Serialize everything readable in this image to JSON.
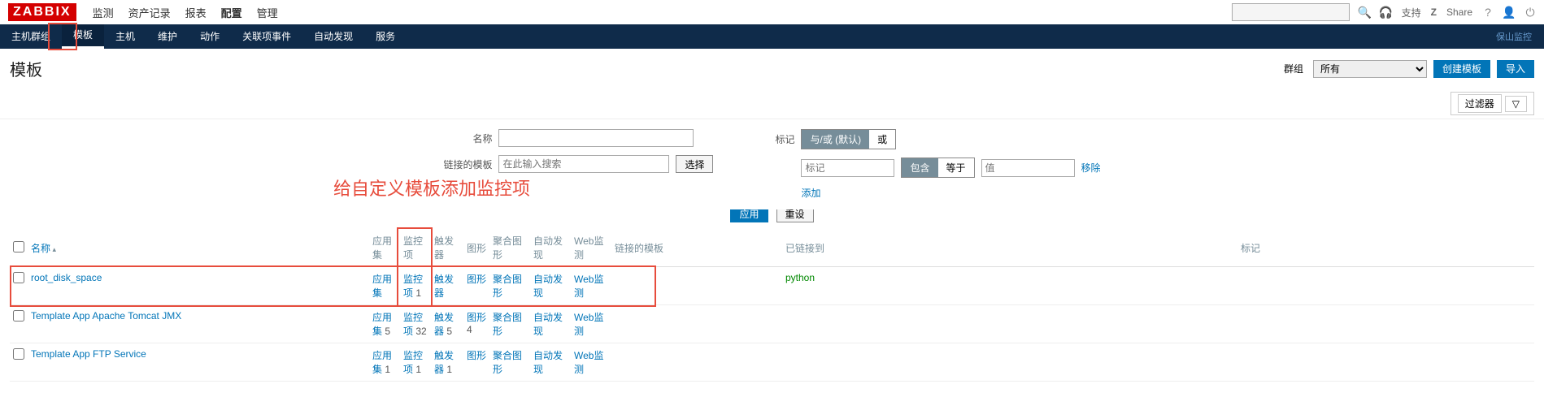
{
  "brand": "ZABBIX",
  "topmenu": [
    "监测",
    "资产记录",
    "报表",
    "配置",
    "管理"
  ],
  "topbar": {
    "support": "支持",
    "share": "Share"
  },
  "subnav": {
    "items": [
      "主机群组",
      "模板",
      "主机",
      "维护",
      "动作",
      "关联项事件",
      "自动发现",
      "服务"
    ],
    "right": "保山监控"
  },
  "page": {
    "title": "模板",
    "group_label": "群组",
    "group_value": "所有",
    "create_btn": "创建模板",
    "import_btn": "导入"
  },
  "filter_toggle": "过滤器",
  "filter": {
    "name_label": "名称",
    "linked_label": "链接的模板",
    "linked_placeholder": "在此输入搜索",
    "select_btn": "选择",
    "tags_label": "标记",
    "tag_mode_and_or": "与/或 (默认)",
    "tag_mode_or": "或",
    "tag_key_placeholder": "标记",
    "contains": "包含",
    "equals": "等于",
    "tag_val_placeholder": "值",
    "remove": "移除",
    "add": "添加",
    "apply": "应用",
    "reset": "重设"
  },
  "annotation": "给自定义模板添加监控项",
  "columns": {
    "name": "名称",
    "apps": "应用集",
    "items": "监控项",
    "triggers": "触发器",
    "graphs": "图形",
    "screens": "聚合图形",
    "discovery": "自动发现",
    "web": "Web监测",
    "linked_tpl": "链接的模板",
    "linked_to": "已链接到",
    "tags": "标记"
  },
  "rows": [
    {
      "name": "root_disk_space",
      "apps": "应用集",
      "apps_n": "",
      "items": "监控项",
      "items_n": "1",
      "triggers": "触发器",
      "triggers_n": "",
      "graphs": "图形",
      "graphs_n": "",
      "screens": "聚合图形",
      "screens_n": "",
      "discovery": "自动发现",
      "discovery_n": "",
      "web": "Web监测",
      "web_n": "",
      "linked_to": "python"
    },
    {
      "name": "Template App Apache Tomcat JMX",
      "apps": "应用集",
      "apps_n": "5",
      "items": "监控项",
      "items_n": "32",
      "triggers": "触发器",
      "triggers_n": "5",
      "graphs": "图形",
      "graphs_n": "4",
      "screens": "聚合图形",
      "screens_n": "",
      "discovery": "自动发现",
      "discovery_n": "",
      "web": "Web监测",
      "web_n": "",
      "linked_to": ""
    },
    {
      "name": "Template App FTP Service",
      "apps": "应用集",
      "apps_n": "1",
      "items": "监控项",
      "items_n": "1",
      "triggers": "触发器",
      "triggers_n": "1",
      "graphs": "图形",
      "graphs_n": "",
      "screens": "聚合图形",
      "screens_n": "",
      "discovery": "自动发现",
      "discovery_n": "",
      "web": "Web监测",
      "web_n": "",
      "linked_to": ""
    }
  ]
}
